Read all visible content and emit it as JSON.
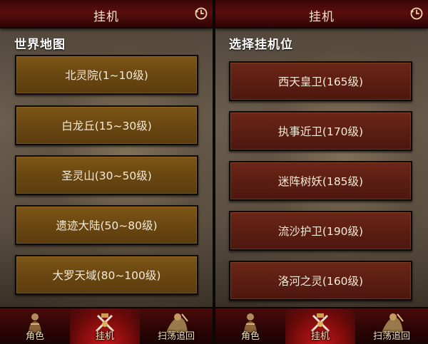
{
  "left_screen": {
    "title": "挂机",
    "icon": "clock-icon",
    "section_title": "世界地图",
    "items": [
      {
        "label": "北灵院(1~10级)"
      },
      {
        "label": "白龙丘(15~30级)"
      },
      {
        "label": "圣灵山(30~50级)"
      },
      {
        "label": "遗迹大陆(50~80级)"
      },
      {
        "label": "大罗天域(80~100级)"
      }
    ],
    "tabs": [
      {
        "label": "角色",
        "icon": "character-icon",
        "active": false
      },
      {
        "label": "挂机",
        "icon": "swords-icon",
        "active": true
      },
      {
        "label": "扫荡追回",
        "icon": "warrior-icon",
        "active": false
      }
    ]
  },
  "right_screen": {
    "title": "挂机",
    "icon": "clock-icon",
    "section_title": "选择挂机位",
    "items": [
      {
        "label": "西天皇卫(165级)"
      },
      {
        "label": "执事近卫(170级)"
      },
      {
        "label": "迷阵树妖(185级)"
      },
      {
        "label": "流沙护卫(190级)"
      },
      {
        "label": "洛河之灵(160级)"
      }
    ],
    "tabs": [
      {
        "label": "角色",
        "icon": "character-icon",
        "active": false
      },
      {
        "label": "挂机",
        "icon": "swords-icon",
        "active": true
      },
      {
        "label": "扫荡追回",
        "icon": "warrior-icon",
        "active": false
      }
    ]
  },
  "colors": {
    "header_red": "#5a0d0d",
    "left_item_brown": "#6a4711",
    "right_item_red": "#5c1e13",
    "text_cream": "#f4ead8",
    "tab_active_red": "#c4171a"
  }
}
